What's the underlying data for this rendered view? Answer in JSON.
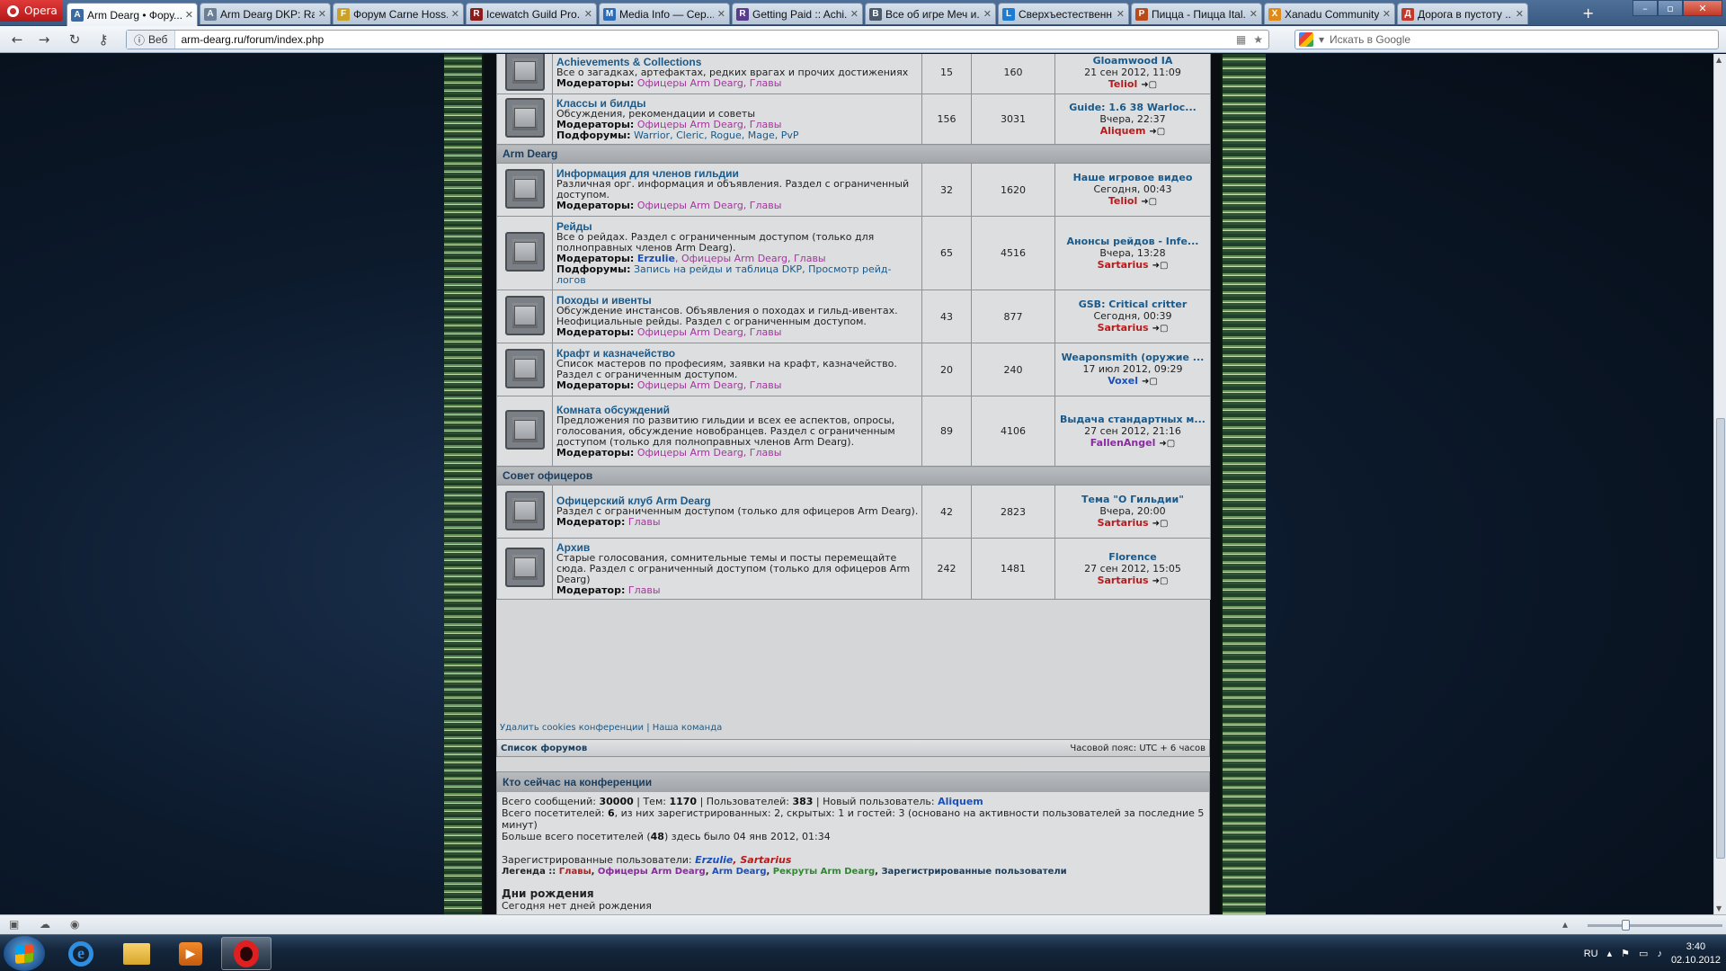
{
  "browser": {
    "menu_label": "Opera",
    "tabs": [
      {
        "title": "Arm Dearg • Фору...",
        "fav": "A",
        "color": "#3b6aa3",
        "active": true
      },
      {
        "title": "Arm Dearg DKP: Ra...",
        "fav": "A",
        "color": "#6a7f95",
        "active": false
      },
      {
        "title": "Форум Carne Hoss...",
        "fav": "F",
        "color": "#c9a227",
        "active": false
      },
      {
        "title": "Icewatch Guild Pro...",
        "fav": "R",
        "color": "#8a1c1c",
        "active": false
      },
      {
        "title": "Media Info — Сер...",
        "fav": "M",
        "color": "#2e6bb5",
        "active": false
      },
      {
        "title": "Getting Paid :: Achi...",
        "fav": "R",
        "color": "#5a3d8a",
        "active": false
      },
      {
        "title": "Все об игре Меч и...",
        "fav": "В",
        "color": "#4b5b6b",
        "active": false
      },
      {
        "title": "Сверхъестественн...",
        "fav": "L",
        "color": "#1d7bd0",
        "active": false
      },
      {
        "title": "Пицца - Пицца Ital...",
        "fav": "P",
        "color": "#b84b1a",
        "active": false
      },
      {
        "title": "Xanadu Community",
        "fav": "X",
        "color": "#e08a1a",
        "active": false
      },
      {
        "title": "Дорога в пустоту ...",
        "fav": "Д",
        "color": "#c0392b",
        "active": false
      }
    ],
    "address": {
      "scheme_label": "Веб",
      "url": "arm-dearg.ru/forum/index.php"
    },
    "search_placeholder": "Искать в Google"
  },
  "forum": {
    "rows_top": [
      {
        "title": "Achievements & Collections",
        "desc": "Все о загадках, артефактах, редких врагах и прочих достижениях",
        "mod_label": "Модераторы:",
        "mods": "Офицеры Arm Dearg, Главы",
        "topics": "15",
        "posts": "160",
        "last_title": "Gloamwood IA",
        "last_date": "21 сен 2012, 11:09",
        "last_user": "Teliol"
      },
      {
        "title": "Классы и билды",
        "desc": "Обсуждения, рекомендации и советы",
        "mod_label": "Модераторы:",
        "mods": "Офицеры Arm Dearg, Главы",
        "sub_label": "Подфорумы:",
        "subs": "Warrior, Cleric, Rogue, Mage, PvP",
        "topics": "156",
        "posts": "3031",
        "last_title": "Guide: 1.6 38 Warloc...",
        "last_date": "Вчера, 22:37",
        "last_user": "Aliquem"
      }
    ],
    "cat_arm_dearg": "Arm Dearg",
    "rows_mid": [
      {
        "title": "Информация для членов гильдии",
        "desc": "Различная орг. информация и объявления. Раздел с ограниченный доступом.",
        "mod_label": "Модераторы:",
        "mods": "Офицеры Arm Dearg, Главы",
        "topics": "32",
        "posts": "1620",
        "last_title": "Наше игровое видео",
        "last_date": "Сегодня, 00:43",
        "last_user": "Teliol"
      },
      {
        "title": "Рейды",
        "desc": "Все о рейдах. Раздел с ограниченным доступом (только для полноправных членов Arm Dearg).",
        "mod_label": "Модераторы:",
        "mod_strong": "Erzulie",
        "mods": ", Офицеры Arm Dearg, Главы",
        "sub_label": "Подфорумы:",
        "subs": "Запись на рейды и таблица DKP, Просмотр рейд-логов",
        "topics": "65",
        "posts": "4516",
        "last_title": "Анонсы рейдов - Infe...",
        "last_date": "Вчера, 13:28",
        "last_user": "Sartarius"
      },
      {
        "title": "Походы и ивенты",
        "desc": "Обсуждение инстансов. Объявления о походах и гильд-ивентах. Неофициальные рейды. Раздел с ограниченным доступом.",
        "mod_label": "Модераторы:",
        "mods": "Офицеры Arm Dearg, Главы",
        "topics": "43",
        "posts": "877",
        "last_title": "GSB: Critical critter",
        "last_date": "Сегодня, 00:39",
        "last_user": "Sartarius"
      },
      {
        "title": "Крафт и казначейство",
        "desc": "Список мастеров по професиям, заявки на крафт, казначейство. Раздел с ограниченным доступом.",
        "mod_label": "Модераторы:",
        "mods": "Офицеры Arm Dearg, Главы",
        "topics": "20",
        "posts": "240",
        "last_title": "Weaponsmith (оружие ...",
        "last_date": "17 июл 2012, 09:29",
        "last_user": "Voxel"
      },
      {
        "title": "Комната обсуждений",
        "desc": "Предложения по развитию гильдии и всех ее аспектов, опросы, голосования, обсуждение новобранцев. Раздел с ограниченным доступом (только для полноправных членов Arm Dearg).",
        "mod_label": "Модераторы:",
        "mods": "Офицеры Arm Dearg, Главы",
        "topics": "89",
        "posts": "4106",
        "last_title": "Выдача стандартных м...",
        "last_date": "27 сен 2012, 21:16",
        "last_user": "FallenAngel"
      }
    ],
    "cat_officers": "Совет офицеров",
    "rows_bot": [
      {
        "title": "Офицерский клуб Arm Dearg",
        "desc": "Раздел с ограниченным доступом (только для офицеров Arm Dearg).",
        "mod_label": "Модератор:",
        "mods": "Главы",
        "topics": "42",
        "posts": "2823",
        "last_title": "Тема \"О Гильдии\"",
        "last_date": "Вчера, 20:00",
        "last_user": "Sartarius"
      },
      {
        "title": "Архив",
        "desc": "Старые голосования, сомнительные темы и посты перемещайте сюда. Раздел с ограниченный доступом (только для офицеров Arm Dearg)",
        "mod_label": "Модератор:",
        "mods": "Главы",
        "topics": "242",
        "posts": "1481",
        "last_title": "Florence",
        "last_date": "27 сен 2012, 15:05",
        "last_user": "Sartarius"
      }
    ],
    "footer_links": "Удалить cookies конференции | Наша команда",
    "board_index": "Список форумов",
    "timezone": "Часовой пояс: UTC + 6 часов",
    "online": {
      "header": "Кто сейчас на конференции",
      "stats": {
        "l1": "Всего сообщений:",
        "posts": "30000",
        "l2": " | Тем:",
        "topics": "1170",
        "l3": " | Пользователей:",
        "users": "383",
        "l4": " | Новый пользователь:",
        "newest": "Aliquem"
      },
      "visitors_a": "Всего посетителей:",
      "visitors_n": "6",
      "visitors_b": ", из них зарегистрированных: 2, скрытых: 1 и гостей: 3 (основано на активности пользователей за последние 5 минут)",
      "max_a": "Больше всего посетителей (",
      "max_n": "48",
      "max_b": ") здесь было 04 янв 2012, 01:34",
      "reg_label": "Зарегистрированные пользователи:",
      "reg_user1": "Erzulie",
      "reg_user2": "Sartarius",
      "legend_label": "Легенда ::",
      "legend": [
        {
          "name": "Главы",
          "color": "#b71c1c"
        },
        {
          "name": "Офицеры Arm Dearg",
          "color": "#8a2aa0"
        },
        {
          "name": "Arm Dearg",
          "color": "#1b50b8"
        },
        {
          "name": "Рекруты Arm Dearg",
          "color": "#2c8a2c"
        },
        {
          "name": "Зарегистрированные пользователи",
          "color": "#1a3d5e"
        }
      ],
      "bday_header": "Дни рождения",
      "bday_text": "Сегодня нет дней рождения"
    }
  },
  "taskbar": {
    "lang": "RU",
    "time": "3:40",
    "date": "02.10.2012"
  }
}
